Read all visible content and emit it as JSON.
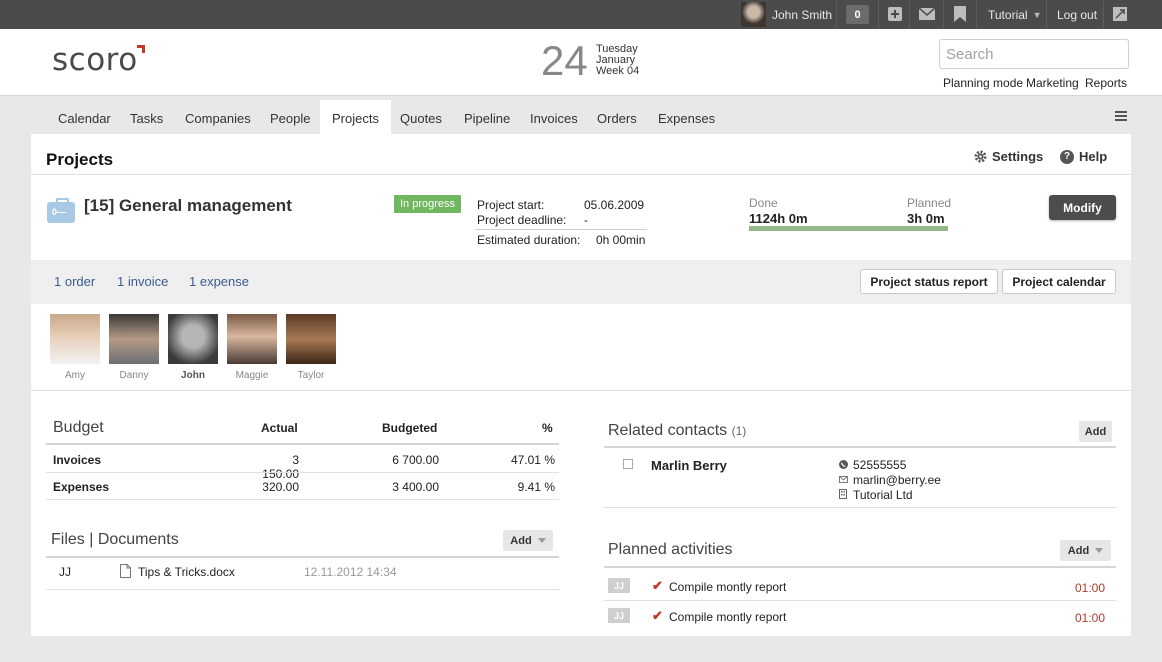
{
  "topbar": {
    "user_name": "John Smith",
    "notification_count": "0",
    "workspace": "Tutorial",
    "logout": "Log out"
  },
  "header": {
    "logo": "scoro",
    "day_number": "24",
    "weekday": "Tuesday",
    "month": "January",
    "week": "Week 04",
    "search_placeholder": "Search",
    "links": [
      "Planning mode",
      "Marketing",
      "Reports"
    ]
  },
  "nav": {
    "tabs": [
      "Calendar",
      "Tasks",
      "Companies",
      "People",
      "Projects",
      "Quotes",
      "Pipeline",
      "Invoices",
      "Orders",
      "Expenses"
    ],
    "active_tab": "Projects"
  },
  "page": {
    "title": "Projects",
    "settings": "Settings",
    "help": "Help"
  },
  "project": {
    "title": "[15] General management",
    "status": "In progress",
    "start_label": "Project start:",
    "start_value": "05.06.2009",
    "deadline_label": "Project deadline:",
    "deadline_value": "-",
    "duration_label": "Estimated duration:",
    "duration_value": "0h 00min",
    "done_label": "Done",
    "done_value": "1124h 0m",
    "planned_label": "Planned",
    "planned_value": "3h 0m",
    "progress_fraction": 1.0,
    "modify": "Modify"
  },
  "related_links": [
    "1 order",
    "1 invoice",
    "1 expense"
  ],
  "report_buttons": [
    "Project status report",
    "Project calendar"
  ],
  "team": [
    {
      "name": "Amy",
      "bold": false
    },
    {
      "name": "Danny",
      "bold": false
    },
    {
      "name": "John",
      "bold": true
    },
    {
      "name": "Maggie",
      "bold": false
    },
    {
      "name": "Taylor",
      "bold": false
    }
  ],
  "budget": {
    "title": "Budget",
    "columns": [
      "Actual",
      "Budgeted",
      "%"
    ],
    "rows": [
      {
        "label": "Invoices",
        "actual": "3 150.00",
        "budgeted": "6 700.00",
        "percent": "47.01 %"
      },
      {
        "label": "Expenses",
        "actual": "320.00",
        "budgeted": "3 400.00",
        "percent": "9.41 %"
      }
    ]
  },
  "files": {
    "title": "Files | Documents",
    "add": "Add",
    "items": [
      {
        "initials": "JJ",
        "name": "Tips & Tricks.docx",
        "date": "12.11.2012 14:34"
      }
    ]
  },
  "contacts": {
    "title": "Related contacts",
    "count": "(1)",
    "add": "Add",
    "items": [
      {
        "name": "Marlin Berry",
        "phone": "52555555",
        "email": "marlin@berry.ee",
        "company": "Tutorial Ltd"
      }
    ]
  },
  "activities": {
    "title": "Planned activities",
    "add": "Add",
    "items": [
      {
        "initials": "JJ",
        "name": "Compile montly report",
        "time": "01:00"
      },
      {
        "initials": "JJ",
        "name": "Compile montly report",
        "time": "01:00"
      }
    ]
  },
  "colors": {
    "accent_red": "#c0392b",
    "status_green": "#6fb85f",
    "progress_green": "#94b889",
    "link_blue": "#3b5c8f"
  }
}
